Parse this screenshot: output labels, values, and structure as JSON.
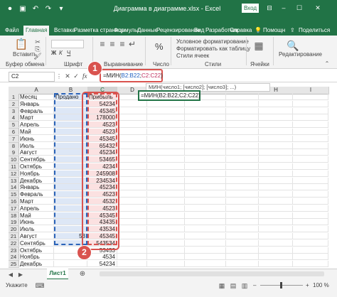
{
  "window": {
    "title": "Диаграмма в диаграмме.xlsx - Excel",
    "login_label": "Вход"
  },
  "tabs": [
    "Файл",
    "Главная",
    "Вставка",
    "Разметка страницы",
    "Формулы",
    "Данные",
    "Рецензирование",
    "Вид",
    "Разработчик",
    "Справка"
  ],
  "tell_me": "Помощн",
  "share": "Поделиться",
  "ribbon": {
    "paste_label": "Вставить",
    "clipboard_label": "Буфер обмена",
    "font_label": "Шрифт",
    "font_bold": "Ж",
    "font_italic": "К",
    "font_underline": "Ч",
    "align_label": "Выравнивание",
    "number_label": "Число",
    "number_pct": "%",
    "styles_items": [
      "Условное форматирование",
      "Форматировать как таблицу",
      "Стили ячеек"
    ],
    "styles_label": "Стили",
    "cells_label": "Ячейки",
    "edit_label": "Редактирование"
  },
  "formula_bar": {
    "name_box": "C2",
    "fx": "fx",
    "prefix": "=МИН(",
    "ref1": "B2:B22",
    "sep": ";",
    "ref2": "C2:C22",
    "suffix": ")"
  },
  "tooltip": "МИН(число1; [число2]; [число3]; ...)",
  "edit_cell_text": "=МИН(B2:B22;C2:C22)",
  "markers": [
    "1",
    "2"
  ],
  "grid": {
    "col_headers": [
      "A",
      "B",
      "C",
      "D",
      "E",
      "F",
      "G",
      "H",
      "I"
    ],
    "header_row": [
      "Месяц",
      "Продано",
      "Прибыль"
    ],
    "rows": [
      [
        "Январь",
        "",
        "54234"
      ],
      [
        "Февраль",
        "",
        "45345"
      ],
      [
        "Март",
        "",
        "178000"
      ],
      [
        "Апрель",
        "",
        "4523"
      ],
      [
        "Май",
        "",
        "4523"
      ],
      [
        "Июнь",
        "",
        "45345"
      ],
      [
        "Июль",
        "",
        "65432"
      ],
      [
        "Август",
        "",
        "45234"
      ],
      [
        "Сентябрь",
        "",
        "53465"
      ],
      [
        "Октябрь",
        "",
        "4234"
      ],
      [
        "Ноябрь",
        "",
        "245908"
      ],
      [
        "Декабрь",
        "",
        "234534"
      ],
      [
        "Январь",
        "",
        "45234"
      ],
      [
        "Февраль",
        "",
        "4523"
      ],
      [
        "Март",
        "",
        "4532"
      ],
      [
        "Апрель",
        "",
        "4523"
      ],
      [
        "Май",
        "",
        "45345"
      ],
      [
        "Июнь",
        "",
        "43435"
      ],
      [
        "Июль",
        "",
        "43534"
      ],
      [
        "Август",
        "53",
        "45345"
      ],
      [
        "Сентябрь",
        "",
        "543534"
      ],
      [
        "Октябрь",
        "",
        "53453"
      ],
      [
        "Ноябрь",
        "",
        "4534"
      ],
      [
        "Декабрь",
        "",
        "54234"
      ]
    ],
    "row_numbers": [
      "1",
      "2",
      "3",
      "4",
      "5",
      "6",
      "7",
      "8",
      "9",
      "10",
      "11",
      "12",
      "13",
      "14",
      "15",
      "16",
      "17",
      "18",
      "19",
      "20",
      "21",
      "22",
      "23",
      "24",
      "25"
    ]
  },
  "sheet_tab": "Лист1",
  "status_left": "Укажите",
  "zoom": "100 %"
}
